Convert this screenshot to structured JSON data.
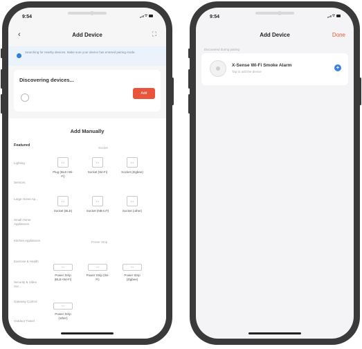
{
  "left_phone": {
    "status_time": "9:54",
    "title": "Add Device",
    "banner_text": "Searching for nearby devices. Make sure your device has entered pairing mode.",
    "discovering_label": "Discovering devices...",
    "add_button_label": "Add",
    "manual_title": "Add Manually",
    "categories": [
      {
        "label": "Featured",
        "selected": true
      },
      {
        "label": "Lighting",
        "selected": false
      },
      {
        "label": "Sensors",
        "selected": false
      },
      {
        "label": "Large Home Ap...",
        "selected": false
      },
      {
        "label": "Small Home Appliances",
        "selected": false
      },
      {
        "label": "Kitchen Appliances",
        "selected": false
      },
      {
        "label": "Exercise & Health",
        "selected": false
      },
      {
        "label": "Security & Video Sur...",
        "selected": false
      },
      {
        "label": "Gateway Control",
        "selected": false
      },
      {
        "label": "Outdoor Travel",
        "selected": false
      }
    ],
    "subheads": {
      "socket": "Socket",
      "power_strip": "Power Strip"
    },
    "devices": [
      {
        "label": "Plug (BLE+Wi-Fi)"
      },
      {
        "label": "Socket (Wi-Fi)"
      },
      {
        "label": "Socket (Zigbee)"
      },
      {
        "label": "Socket (BLE)"
      },
      {
        "label": "Socket (NB-IoT)"
      },
      {
        "label": "Socket (other)"
      },
      {
        "label": "Power Strip (BLE+Wi-Fi)"
      },
      {
        "label": "Power Strip (Wi-Fi)"
      },
      {
        "label": "Power Strip (Zigbee)"
      },
      {
        "label": "Power Strip (other)"
      }
    ]
  },
  "right_phone": {
    "status_time": "9:54",
    "title": "Add Device",
    "done_label": "Done",
    "section_label": "Discovered during pairing",
    "device_name": "X-Sense Wi-Fi Smoke Alarm",
    "device_hint": "Tap to add the device"
  },
  "colors": {
    "accent": "#e9553b",
    "blue": "#3d7fdc"
  }
}
